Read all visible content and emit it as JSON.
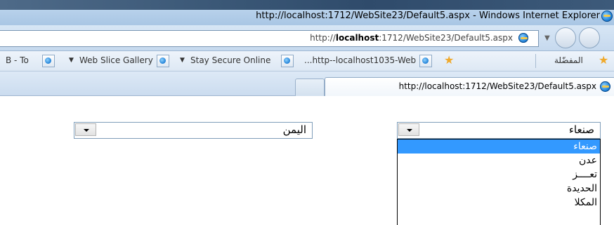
{
  "window": {
    "title": "http://localhost:1712/WebSite23/Default5.aspx - Windows Internet Explorer"
  },
  "address_bar": {
    "url_prefix": "http://",
    "url_host": "localhost",
    "url_rest": ":1712/WebSite23/Default5.aspx"
  },
  "favorites_bar": {
    "favorites_label": "المفضّلة",
    "items": [
      {
        "label": "...http--localhost1035-Web"
      },
      {
        "label": "Stay Secure Online"
      },
      {
        "label": "Web Slice Gallery"
      },
      {
        "label": "B - To"
      }
    ],
    "dropdown_glyph": "▼"
  },
  "tabs": {
    "active_label": "http://localhost:1712/WebSite23/Default5.aspx"
  },
  "page": {
    "city_select": {
      "value": "صنعاء",
      "options": [
        "صنعاء",
        "عدن",
        "تعــــز",
        "الحديدة",
        "المكلا"
      ],
      "selected_index": 0
    },
    "country_select": {
      "value": "اليمن"
    }
  }
}
